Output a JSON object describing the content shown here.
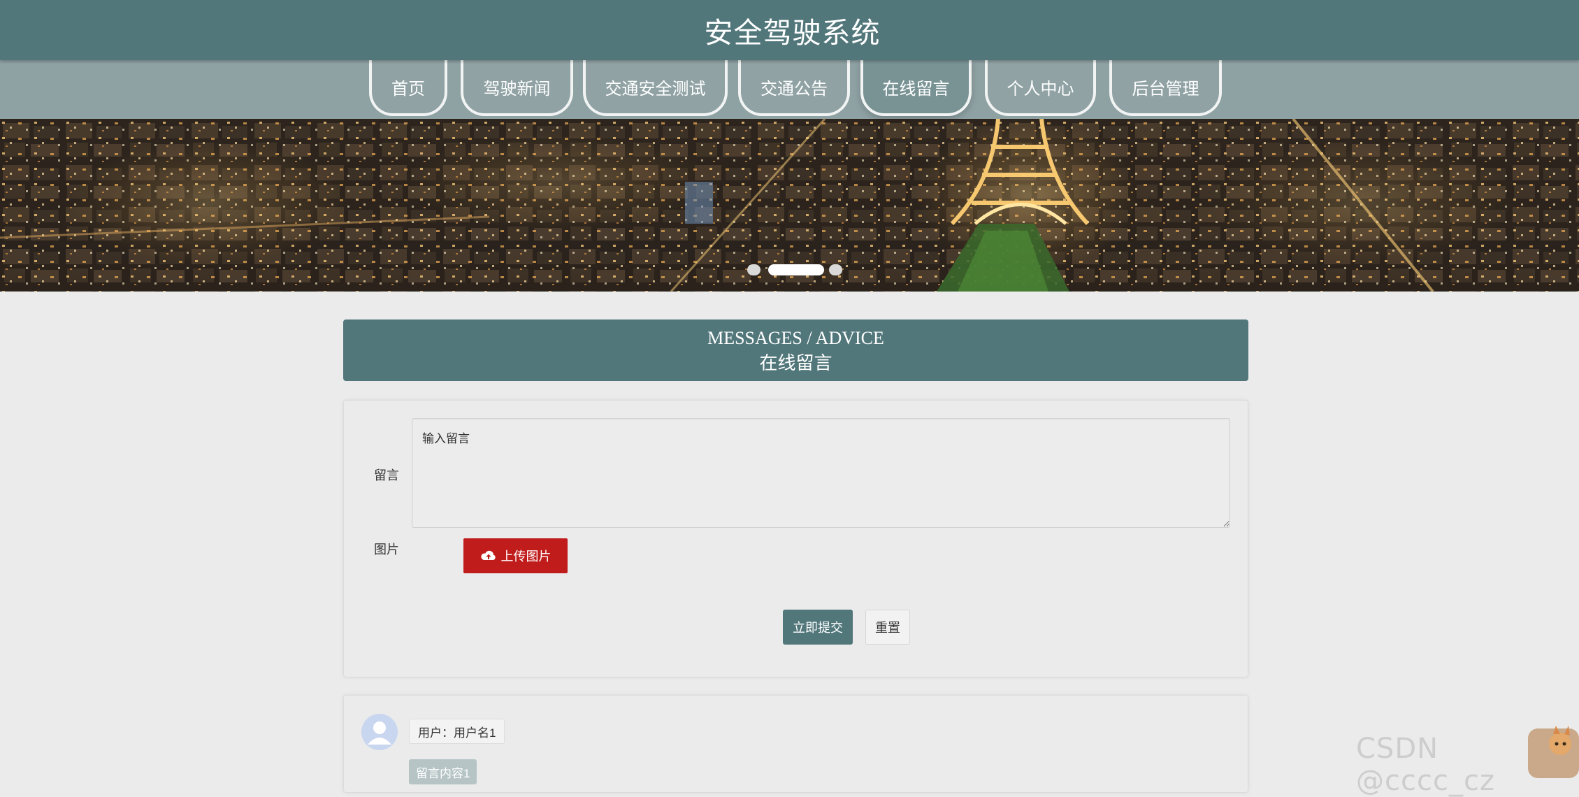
{
  "header": {
    "site_title": "安全驾驶系统"
  },
  "nav": {
    "items": [
      {
        "label": "首页",
        "active": false
      },
      {
        "label": "驾驶新闻",
        "active": false
      },
      {
        "label": "交通安全测试",
        "active": false
      },
      {
        "label": "交通公告",
        "active": false
      },
      {
        "label": "在线留言",
        "active": true
      },
      {
        "label": "个人中心",
        "active": false
      },
      {
        "label": "后台管理",
        "active": false
      }
    ]
  },
  "banner": {
    "slide_count": 3,
    "active_slide": 2
  },
  "section": {
    "title_en": "MESSAGES / ADVICE",
    "title_zh": "在线留言"
  },
  "form": {
    "message_label": "留言",
    "message_placeholder": "输入留言",
    "image_label": "图片",
    "upload_label": "上传图片",
    "upload_icon": "cloud-upload-icon",
    "submit_label": "立即提交",
    "reset_label": "重置"
  },
  "messages": [
    {
      "user_text": "用户：用户名1",
      "content_text": "留言内容1",
      "avatar_icon": "user-avatar-icon"
    }
  ],
  "watermark": {
    "text": "CSDN @cccc_cz"
  },
  "colors": {
    "primary": "#52777b",
    "nav_bg": "#8ea1a3",
    "page_bg": "#ebebeb",
    "upload_red": "#c11c1c"
  }
}
